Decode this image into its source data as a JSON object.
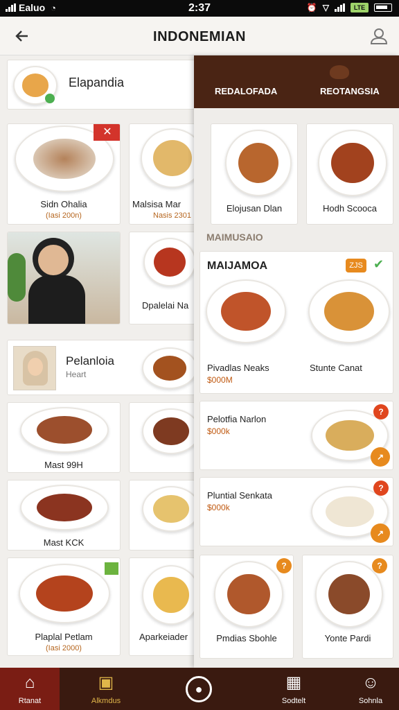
{
  "status_bar": {
    "carrier": "Ealuo",
    "time": "2:37",
    "net_badge": "LTE"
  },
  "header": {
    "title": "INDONEMIAN"
  },
  "left": {
    "top_card": {
      "title": "Elapandia"
    },
    "grid": [
      {
        "name": "Sidn Ohalia",
        "price": "(Iasi 200n)"
      },
      {
        "name": "Malsisa Mar",
        "price": "Nasis 2301"
      },
      {
        "name": "",
        "price": ""
      },
      {
        "name": "Dpalelai Na",
        "price": ""
      }
    ],
    "profile": {
      "title": "Pelanloia",
      "subtitle": "Heart"
    },
    "grid2": [
      {
        "name": "Mast 99H"
      },
      {
        "name": ""
      },
      {
        "name": "Mast KCK"
      },
      {
        "name": ""
      },
      {
        "name": "Plaplal Petlam",
        "price": "(Iasi 2000)"
      },
      {
        "name": "Aparkeiader"
      }
    ]
  },
  "panel": {
    "tabs": [
      "REDALOFADA",
      "REOTANGSIA"
    ],
    "top_items": [
      {
        "name": "Elojusan Dlan"
      },
      {
        "name": "Hodh Scooca"
      }
    ],
    "section_label": "MAIMUSAIO",
    "feature": {
      "title": "MAIJAMOA",
      "badge": "ZJS",
      "items": [
        {
          "name": "Pivadlas Neaks",
          "price": "$000M"
        },
        {
          "name": "Stunte Canat",
          "price": ""
        }
      ]
    },
    "rows": [
      {
        "title": "Pelotfia Narlon",
        "price": "$000k",
        "badge": "?"
      },
      {
        "title": "Pluntial Senkata",
        "price": "$000k",
        "badge": "?"
      }
    ],
    "bottom_items": [
      {
        "name": "Pmdias Sbohle",
        "badge": "?"
      },
      {
        "name": "Yonte Pardi",
        "badge": "?"
      }
    ]
  },
  "nav": {
    "items": [
      {
        "label": "Rtanat",
        "icon": "home-icon"
      },
      {
        "label": "Alkmdus",
        "icon": "shop-icon"
      },
      {
        "label": "",
        "icon": "camera-icon"
      },
      {
        "label": "Sodtelt",
        "icon": "qr-icon"
      },
      {
        "label": "Sohnla",
        "icon": "person-icon"
      }
    ]
  },
  "colors": {
    "brown": "#4a2414",
    "nav": "#3a1a10",
    "accent": "#e78a1e",
    "price": "#c05a12"
  }
}
